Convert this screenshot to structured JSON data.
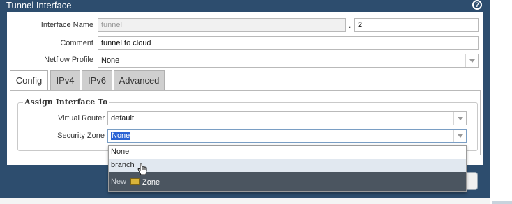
{
  "dialog": {
    "title": "Tunnel Interface",
    "help_icon_glyph": "?"
  },
  "form": {
    "interface_name_label": "Interface Name",
    "interface_name_value": "tunnel",
    "separator": ".",
    "interface_suffix_value": "2",
    "comment_label": "Comment",
    "comment_value": "tunnel to cloud",
    "netflow_label": "Netflow Profile",
    "netflow_value": "None"
  },
  "tabs": [
    {
      "label": "Config",
      "active": true
    },
    {
      "label": "IPv4",
      "active": false
    },
    {
      "label": "IPv6",
      "active": false
    },
    {
      "label": "Advanced",
      "active": false
    }
  ],
  "config": {
    "section_title": "Assign Interface To",
    "virtual_router_label": "Virtual Router",
    "virtual_router_value": "default",
    "security_zone_label": "Security Zone",
    "security_zone_value": "None"
  },
  "zone_dropdown": {
    "options": [
      "None",
      "branch"
    ],
    "hovered": "branch",
    "new_label": "New",
    "new_item_label": "Zone",
    "new_item_icon": "zone-icon"
  },
  "colors": {
    "header": "#2d4d6e",
    "selection": "#2a62d4",
    "new_bar": "#4b5560"
  }
}
